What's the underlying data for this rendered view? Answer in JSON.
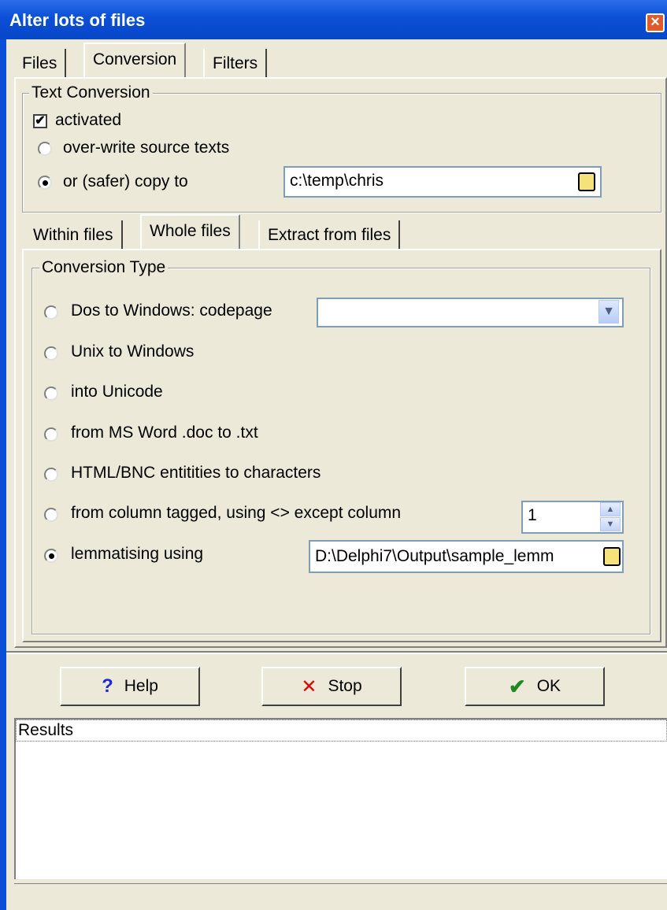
{
  "window": {
    "title": "Alter lots of files"
  },
  "tabs": [
    {
      "label": "Files",
      "active": false
    },
    {
      "label": "Conversion",
      "active": true
    },
    {
      "label": "Filters",
      "active": false
    }
  ],
  "text_conversion": {
    "legend": "Text Conversion",
    "activated_label": "activated",
    "activated_checked": true,
    "overwrite_label": "over-write source texts",
    "copy_label": "or (safer) copy to",
    "copy_path": "c:\\temp\\chris",
    "selected_mode": "copy"
  },
  "subtabs": [
    {
      "label": "Within files",
      "active": false
    },
    {
      "label": "Whole files",
      "active": true
    },
    {
      "label": "Extract from files",
      "active": false
    }
  ],
  "conversion_type": {
    "legend": "Conversion Type",
    "options": [
      {
        "label": "Dos to Windows: codepage",
        "checked": false
      },
      {
        "label": "Unix to Windows",
        "checked": false
      },
      {
        "label": "into Unicode",
        "checked": false
      },
      {
        "label": "from MS Word .doc to .txt",
        "checked": false
      },
      {
        "label": "HTML/BNC entitities to characters",
        "checked": false
      },
      {
        "label": "from column tagged, using <> except column",
        "checked": false
      },
      {
        "label": "lemmatising using",
        "checked": true
      }
    ],
    "codepage_value": "",
    "column_value": "1",
    "lemma_path": "D:\\Delphi7\\Output\\sample_lemm"
  },
  "buttons": {
    "help_label": "Help",
    "stop_label": "Stop",
    "ok_label": "OK"
  },
  "results": {
    "header": "Results"
  },
  "icons": {
    "help": "question-icon",
    "stop": "x-icon",
    "ok": "check-icon",
    "folder": "folder-icon",
    "close": "close-icon"
  },
  "colors": {
    "titlebar": "#0a4fd6",
    "help_icon": "#1a2ad6",
    "stop_icon": "#e00000",
    "ok_icon": "#1f8a1f"
  }
}
